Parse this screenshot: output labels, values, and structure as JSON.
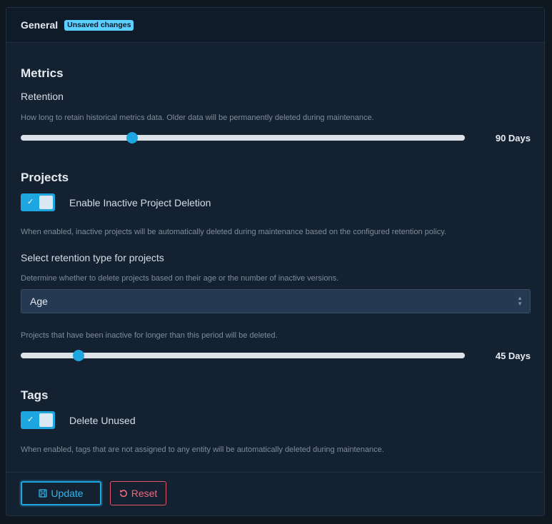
{
  "header": {
    "title": "General",
    "badge": "Unsaved changes"
  },
  "metrics": {
    "title": "Metrics",
    "retention_label": "Retention",
    "retention_help": "How long to retain historical metrics data. Older data will be permanently deleted during maintenance.",
    "retention_value": "90 Days",
    "retention_slider_fraction": 0.25
  },
  "projects": {
    "title": "Projects",
    "inactive_toggle_label": "Enable Inactive Project Deletion",
    "inactive_toggle_on": true,
    "inactive_help": "When enabled, inactive projects will be automatically deleted during maintenance based on the configured retention policy.",
    "retention_type_label": "Select retention type for projects",
    "retention_type_help": "Determine whether to delete projects based on their age or the number of inactive versions.",
    "retention_type_value": "Age",
    "age_help": "Projects that have been inactive for longer than this period will be deleted.",
    "age_value": "45 Days",
    "age_slider_fraction": 0.13
  },
  "tags": {
    "title": "Tags",
    "unused_toggle_label": "Delete Unused",
    "unused_toggle_on": true,
    "unused_help": "When enabled, tags that are not assigned to any entity will be automatically deleted during maintenance."
  },
  "footer": {
    "update_label": "Update",
    "reset_label": "Reset"
  },
  "colors": {
    "accent": "#1da6e0",
    "badge": "#5bcfff",
    "danger": "#e0566a"
  },
  "icons": {
    "toggle_check": "✓",
    "update_icon": "save-icon",
    "reset_icon": "undo-icon"
  }
}
